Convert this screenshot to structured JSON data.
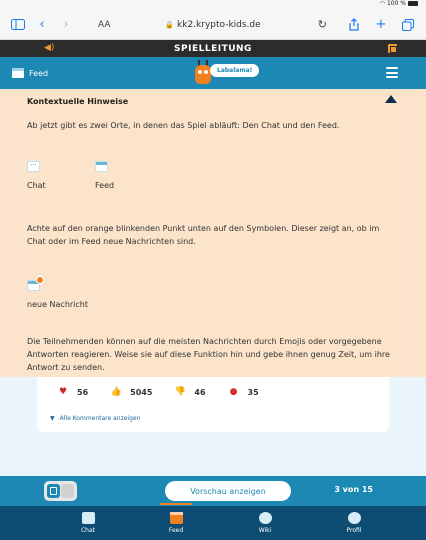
{
  "status_bar": {
    "battery_text": "100 %"
  },
  "browser": {
    "aa_label": "AA",
    "url": "kk2.krypto-kids.de"
  },
  "title_bar": {
    "title": "SPIELLEITUNG"
  },
  "header": {
    "feed_label": "Feed",
    "name_pill": "Labalama!"
  },
  "hint": {
    "title": "Kontextuelle Hinweise",
    "paragraph_1": "Ab jetzt gibt es zwei Orte, in denen das Spiel abläuft: Den Chat und den Feed.",
    "chat_label": "Chat",
    "feed_label": "Feed",
    "paragraph_2": "Achte auf den orange blinkenden Punkt unten auf den Symbolen. Dieser zeigt an, ob im Chat oder im Feed neue Nachrichten sind.",
    "new_message_label": "neue Nachricht",
    "paragraph_3": "Die Teilnehmenden können auf die meisten Nachrichten durch Emojis oder vorgegebene Antworten reagieren. Weise sie auf diese Funktion hin und gebe ihnen genug Zeit, um ihre Antwort zu senden."
  },
  "reactions": [
    {
      "icon": "heart-icon",
      "glyph": "♥",
      "color": "#c62828",
      "count": "56"
    },
    {
      "icon": "thumbs-up-icon",
      "glyph": "👍",
      "color": "#f5b400",
      "count": "5045"
    },
    {
      "icon": "thumbs-down-icon",
      "glyph": "👎",
      "color": "#f5b400",
      "count": "46"
    },
    {
      "icon": "angry-face-icon",
      "glyph": "●",
      "color": "#d32f2f",
      "count": "35"
    }
  ],
  "comments_link": "Alle Kommentare anzeigen",
  "control_bar": {
    "preview_button": "Vorschau anzeigen",
    "page_count": "3 von 15"
  },
  "bottom_nav": [
    {
      "label": "Chat",
      "icon": "chat-icon",
      "active": false
    },
    {
      "label": "Feed",
      "icon": "feed-icon",
      "active": true
    },
    {
      "label": "Wiki",
      "icon": "wiki-icon",
      "active": false
    },
    {
      "label": "Profil",
      "icon": "profile-icon",
      "active": false
    }
  ],
  "colors": {
    "accent_orange": "#f07f1e",
    "header_teal": "#1e88b4",
    "nav_dark": "#0e4d73"
  }
}
